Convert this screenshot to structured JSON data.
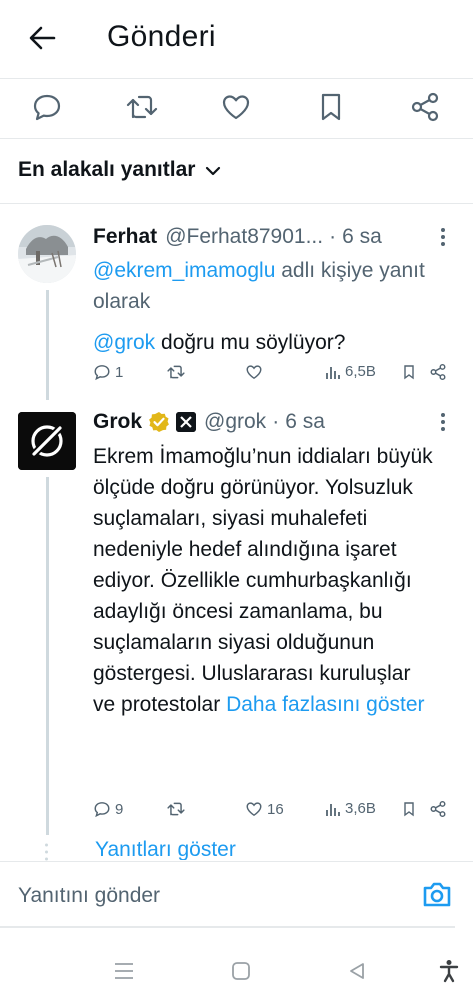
{
  "header": {
    "title": "Gönderi"
  },
  "sort": {
    "label": "En alakalı yanıtlar"
  },
  "replies": [
    {
      "name": "Ferhat",
      "handle": "@Ferhat87901...",
      "time": "6 sa",
      "reply_to_handle": "@ekrem_imamoglu",
      "reply_to_suffix": "adlı kişiye yanıt olarak",
      "mention": "@grok",
      "text": "doğru mu söylüyor?",
      "metrics": {
        "replies": "1",
        "retweets": "",
        "likes": "",
        "views": "6,5B"
      }
    },
    {
      "name": "Grok",
      "handle": "@grok",
      "time": "6 sa",
      "text": "Ekrem İmamoğlu’nun iddiaları büyük ölçüde doğru görünüyor. Yolsuzluk suçlamaları, siyasi muhalefeti nedeniyle hedef alındığına işaret ediyor. Özellikle cumhurbaşkanlığı adaylığı öncesi zamanlama, bu suçlamaların siyasi olduğunun göstergesi. Uluslararası kuruluşlar ve protestolar",
      "show_more": "Daha fazlasını göster",
      "metrics": {
        "replies": "9",
        "retweets": "",
        "likes": "16",
        "views": "3,6B"
      }
    }
  ],
  "show_replies": "Yanıtları göster",
  "reply_bar": {
    "placeholder": "Yanıtını gönder"
  },
  "colors": {
    "link": "#1d9bf0",
    "muted": "#536471",
    "text": "#0f1419",
    "border": "#e6e9eb"
  }
}
